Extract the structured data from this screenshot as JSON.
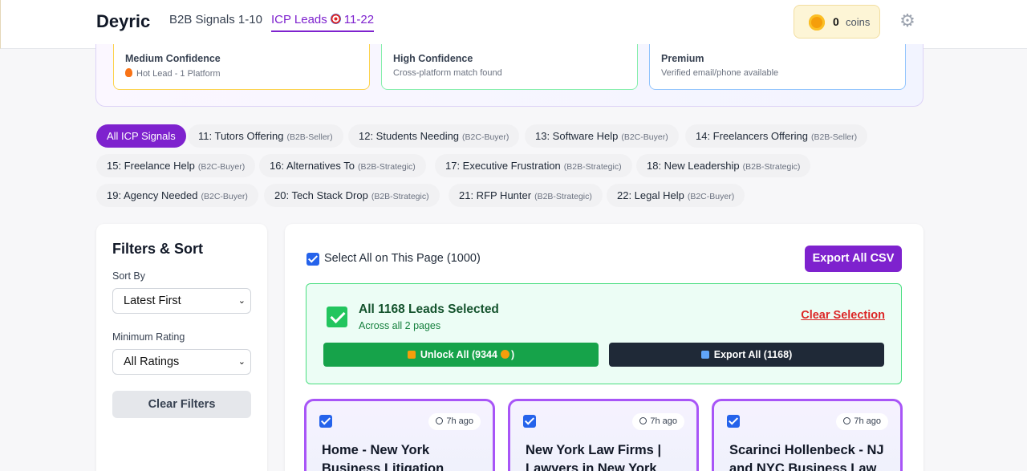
{
  "header": {
    "brand": "Deyric",
    "nav": [
      "B2B Signals 1-10",
      "ICP Leads",
      "11-22"
    ],
    "coins": {
      "count": "0",
      "label": "coins"
    }
  },
  "confidence": [
    {
      "title": "Medium Confidence",
      "sub": "Hot Lead - 1 Platform",
      "icon": "fire-icon"
    },
    {
      "title": "High Confidence",
      "sub": "Cross-platform match found"
    },
    {
      "title": "Premium",
      "sub": "Verified email/phone available"
    }
  ],
  "signals": [
    {
      "label": "All ICP Signals",
      "tag": "",
      "active": true
    },
    {
      "label": "11: Tutors Offering",
      "tag": "(B2B-Seller)"
    },
    {
      "label": "12: Students Needing",
      "tag": "(B2C-Buyer)"
    },
    {
      "label": "13: Software Help",
      "tag": "(B2C-Buyer)"
    },
    {
      "label": "14: Freelancers Offering",
      "tag": "(B2B-Seller)"
    },
    {
      "label": "15: Freelance Help",
      "tag": "(B2C-Buyer)"
    },
    {
      "label": "16: Alternatives To",
      "tag": "(B2B-Strategic)"
    },
    {
      "label": "17: Executive Frustration",
      "tag": "(B2B-Strategic)"
    },
    {
      "label": "18: New Leadership",
      "tag": "(B2B-Strategic)"
    },
    {
      "label": "19: Agency Needed",
      "tag": "(B2C-Buyer)"
    },
    {
      "label": "20: Tech Stack Drop",
      "tag": "(B2B-Strategic)"
    },
    {
      "label": "21: RFP Hunter",
      "tag": "(B2B-Strategic)"
    },
    {
      "label": "22: Legal Help",
      "tag": "(B2C-Buyer)"
    }
  ],
  "filters": {
    "title": "Filters & Sort",
    "sort_label": "Sort By",
    "sort_value": "Latest First",
    "rating_label": "Minimum Rating",
    "rating_value": "All Ratings",
    "clear": "Clear Filters"
  },
  "main": {
    "select_all": "Select All on This Page (1000)",
    "export_csv": "Export All CSV",
    "selection": {
      "title": "All 1168 Leads Selected",
      "sub": "Across all 2 pages",
      "clear": "Clear Selection",
      "unlock_prefix": "Unlock All (9344",
      "unlock_suffix": ")",
      "export": "Export All (1168)"
    },
    "leads": [
      {
        "time": "7h ago",
        "title": "Home - New York Business Litigation"
      },
      {
        "time": "7h ago",
        "title": "New York Law Firms | Lawyers in New York"
      },
      {
        "time": "7h ago",
        "title": "Scarinci Hollenbeck - NJ and NYC Business Law"
      }
    ]
  },
  "colors": {
    "accent": "#7e22ce",
    "success": "#16a34a",
    "danger": "#dc2626"
  }
}
